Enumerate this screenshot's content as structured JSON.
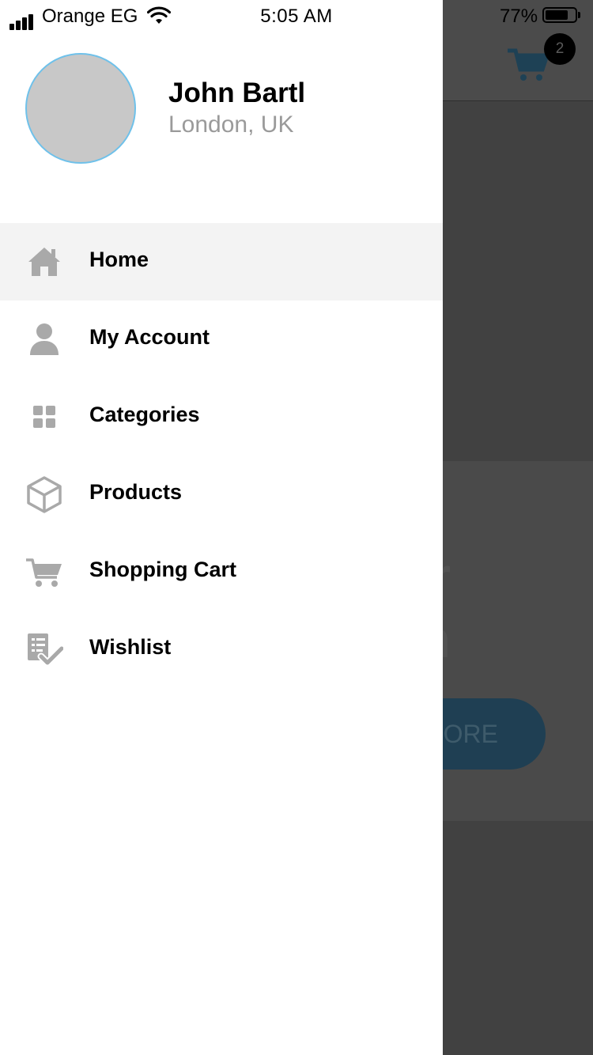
{
  "status_bar": {
    "carrier": "Orange EG",
    "time": "5:05 AM",
    "battery_percent": "77%",
    "battery_level": 0.77
  },
  "profile": {
    "name": "John Bartl",
    "location": "London, UK"
  },
  "menu": {
    "items": [
      {
        "label": "Home",
        "icon": "home-icon",
        "active": true
      },
      {
        "label": "My Account",
        "icon": "user-icon",
        "active": false
      },
      {
        "label": "Categories",
        "icon": "grid-icon",
        "active": false
      },
      {
        "label": "Products",
        "icon": "box-icon",
        "active": false
      },
      {
        "label": "Shopping Cart",
        "icon": "cart-icon",
        "active": false
      },
      {
        "label": "Wishlist",
        "icon": "checklist-icon",
        "active": false
      }
    ]
  },
  "background": {
    "cart_badge_count": "2",
    "banner_title": "r\nn",
    "banner_button": "ORE"
  },
  "colors": {
    "drawer_bg": "#ffffff",
    "active_item_bg": "#f3f3f3",
    "icon_gray": "#a9a9a9",
    "avatar_border": "#6fc1ea",
    "overlay": "#414141",
    "accent_blue": "#1f3f53"
  }
}
